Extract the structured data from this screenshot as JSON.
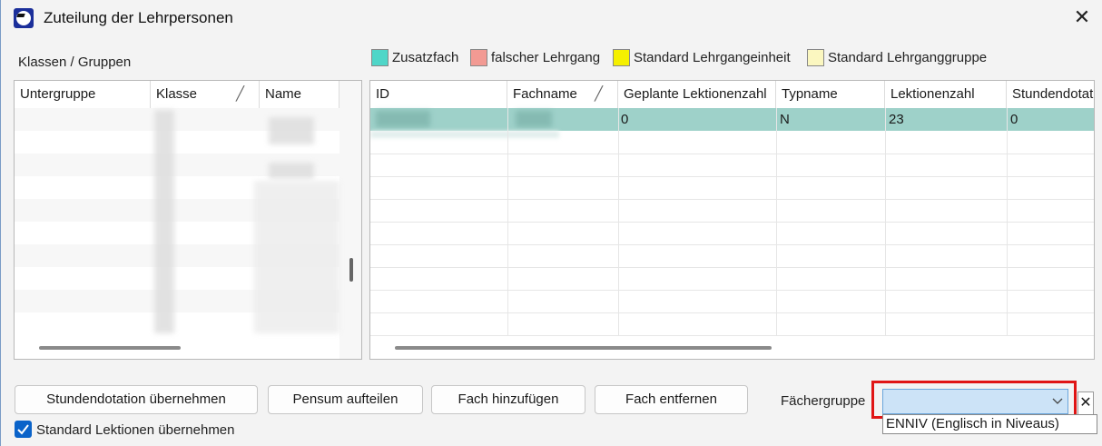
{
  "window": {
    "title": "Zuteilung der Lehrpersonen",
    "close_glyph": "✕"
  },
  "left_panel": {
    "label": "Klassen / Gruppen",
    "columns": [
      "Untergruppe",
      "Klasse",
      "Name"
    ]
  },
  "legend": [
    {
      "label": "Zusatzfach",
      "color": "#4fd6c8"
    },
    {
      "label": "falscher Lehrgang",
      "color": "#f29a93"
    },
    {
      "label": "Standard Lehrgangeinheit",
      "color": "#f5f000"
    },
    {
      "label": "Standard Lehrganggruppe",
      "color": "#fbf7c0"
    }
  ],
  "right_grid": {
    "columns": [
      "ID",
      "Fachname",
      "Geplante Lektionenzahl",
      "Typname",
      "Lektionenzahl",
      "Stundendotat"
    ],
    "rows": [
      {
        "id": "",
        "fachname": "",
        "geplante": "0",
        "typname": "N",
        "lektionenzahl": "23",
        "stundendotation": "0"
      }
    ],
    "selected_row_color": "#9ed1c9"
  },
  "buttons": {
    "stundendotation": "Stundendotation übernehmen",
    "pensum": "Pensum aufteilen",
    "fach_hinzufuegen": "Fach hinzufügen",
    "fach_entfernen": "Fach entfernen"
  },
  "checkbox": {
    "label": "Standard Lektionen übernehmen",
    "checked": true
  },
  "faechergruppe": {
    "label": "Fächergruppe",
    "value": "",
    "clear_glyph": "✕",
    "dropdown_option": "ENNIV (Englisch in Niveaus)"
  }
}
